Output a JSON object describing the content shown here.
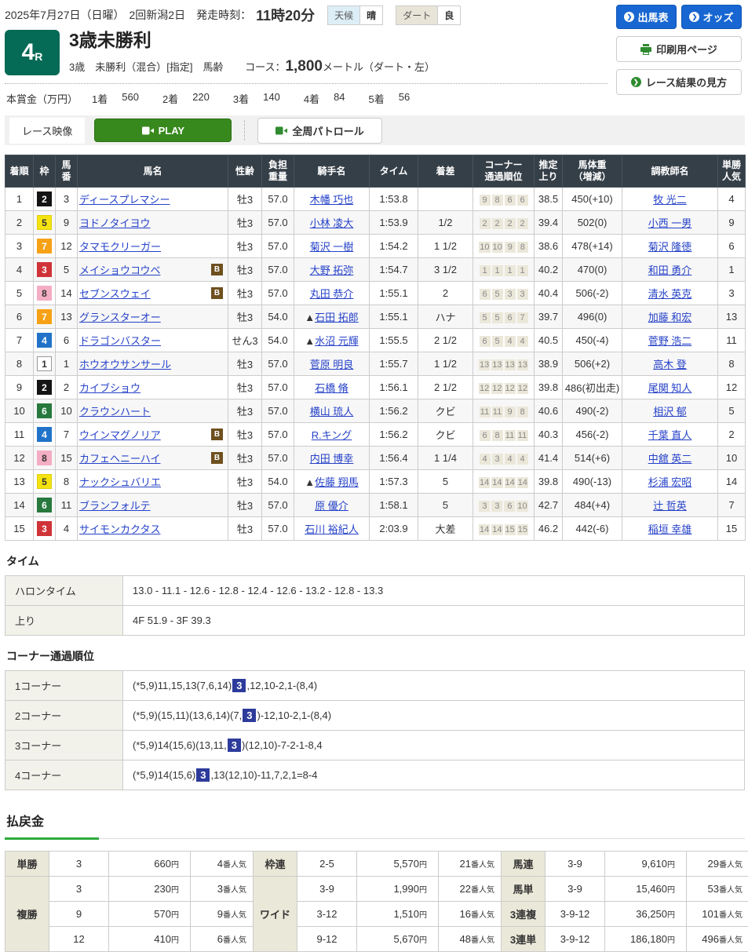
{
  "header": {
    "date": "2025年7月27日（日曜）",
    "meeting": "2回新潟2日",
    "start_label": "発走時刻：",
    "start_time": "11時20分",
    "weather_label": "天候",
    "weather_value": "晴",
    "track_label": "ダート",
    "track_value": "良",
    "btn_shutsuba": "出馬表",
    "btn_odds": "オッズ",
    "btn_print": "印刷用ページ",
    "btn_guide": "レース結果の見方"
  },
  "race": {
    "number": "4",
    "number_suffix": "R",
    "title": "3歳未勝利",
    "conditions": "3歳　未勝利（混合）[指定]　馬齢",
    "course_label": "コース：",
    "course_value": "1,800",
    "course_unit": "メートル（ダート・左）",
    "prize_label": "本賞金（万円）",
    "prizes": [
      {
        "place": "1着",
        "amount": "560"
      },
      {
        "place": "2着",
        "amount": "220"
      },
      {
        "place": "3着",
        "amount": "140"
      },
      {
        "place": "4着",
        "amount": "84"
      },
      {
        "place": "5着",
        "amount": "56"
      }
    ]
  },
  "video": {
    "label": "レース映像",
    "play": "PLAY",
    "patrol": "全周パトロール"
  },
  "waku_colors": {
    "1": {
      "bg": "#ffffff",
      "fg": "#333333",
      "border": "#999999"
    },
    "2": {
      "bg": "#141414",
      "fg": "#ffffff",
      "border": "#141414"
    },
    "3": {
      "bg": "#cf3337",
      "fg": "#ffffff",
      "border": "#cf3337"
    },
    "4": {
      "bg": "#2173c9",
      "fg": "#ffffff",
      "border": "#2173c9"
    },
    "5": {
      "bg": "#f5e311",
      "fg": "#333333",
      "border": "#e0cf10"
    },
    "6": {
      "bg": "#27793d",
      "fg": "#ffffff",
      "border": "#27793d"
    },
    "7": {
      "bg": "#f7a117",
      "fg": "#ffffff",
      "border": "#f7a117"
    },
    "8": {
      "bg": "#f4aec4",
      "fg": "#333333",
      "border": "#f4aec4"
    }
  },
  "results": {
    "blinker_label": "B",
    "headers": [
      "着順",
      "枠",
      "馬\n番",
      "馬名",
      "性齢",
      "負担\n重量",
      "騎手名",
      "タイム",
      "着差",
      "コーナー\n通過順位",
      "推定\n上り",
      "馬体重\n（増減）",
      "調教師名",
      "単勝\n人気"
    ],
    "rows": [
      {
        "pos": "1",
        "waku": "2",
        "num": "3",
        "horse": "ディースプレマシー",
        "blinker": false,
        "sexage": "牡3",
        "weight": "57.0",
        "jprefix": "",
        "jockey": "木幡 巧也",
        "time": "1:53.8",
        "margin": "",
        "corners": [
          "9",
          "8",
          "6",
          "6"
        ],
        "agari": "38.5",
        "hweight": "450(+10)",
        "trainer": "牧 光二",
        "pop": "4"
      },
      {
        "pos": "2",
        "waku": "5",
        "num": "9",
        "horse": "ヨドノタイヨウ",
        "blinker": false,
        "sexage": "牡3",
        "weight": "57.0",
        "jprefix": "",
        "jockey": "小林 凌大",
        "time": "1:53.9",
        "margin": "1/2",
        "corners": [
          "2",
          "2",
          "2",
          "2"
        ],
        "agari": "39.4",
        "hweight": "502(0)",
        "trainer": "小西 一男",
        "pop": "9"
      },
      {
        "pos": "3",
        "waku": "7",
        "num": "12",
        "horse": "タマモクリーガー",
        "blinker": false,
        "sexage": "牡3",
        "weight": "57.0",
        "jprefix": "",
        "jockey": "菊沢 一樹",
        "time": "1:54.2",
        "margin": "1 1/2",
        "corners": [
          "10",
          "10",
          "9",
          "8"
        ],
        "agari": "38.6",
        "hweight": "478(+14)",
        "trainer": "菊沢 隆徳",
        "pop": "6"
      },
      {
        "pos": "4",
        "waku": "3",
        "num": "5",
        "horse": "メイショウコウベ",
        "blinker": true,
        "sexage": "牡3",
        "weight": "57.0",
        "jprefix": "",
        "jockey": "大野 拓弥",
        "time": "1:54.7",
        "margin": "3 1/2",
        "corners": [
          "1",
          "1",
          "1",
          "1"
        ],
        "agari": "40.2",
        "hweight": "470(0)",
        "trainer": "和田 勇介",
        "pop": "1"
      },
      {
        "pos": "5",
        "waku": "8",
        "num": "14",
        "horse": "セブンスウェイ",
        "blinker": true,
        "sexage": "牡3",
        "weight": "57.0",
        "jprefix": "",
        "jockey": "丸田 恭介",
        "time": "1:55.1",
        "margin": "2",
        "corners": [
          "6",
          "5",
          "3",
          "3"
        ],
        "agari": "40.4",
        "hweight": "506(-2)",
        "trainer": "清水 英克",
        "pop": "3"
      },
      {
        "pos": "6",
        "waku": "7",
        "num": "13",
        "horse": "グランスターオー",
        "blinker": false,
        "sexage": "牡3",
        "weight": "54.0",
        "jprefix": "▲",
        "jockey": "石田 拓郎",
        "time": "1:55.1",
        "margin": "ハナ",
        "corners": [
          "5",
          "5",
          "6",
          "7"
        ],
        "agari": "39.7",
        "hweight": "496(0)",
        "trainer": "加藤 和宏",
        "pop": "13"
      },
      {
        "pos": "7",
        "waku": "4",
        "num": "6",
        "horse": "ドラゴンバスター",
        "blinker": false,
        "sexage": "せん3",
        "weight": "54.0",
        "jprefix": "▲",
        "jockey": "水沼 元輝",
        "time": "1:55.5",
        "margin": "2 1/2",
        "corners": [
          "6",
          "5",
          "4",
          "4"
        ],
        "agari": "40.5",
        "hweight": "450(-4)",
        "trainer": "菅野 浩二",
        "pop": "11"
      },
      {
        "pos": "8",
        "waku": "1",
        "num": "1",
        "horse": "ホウオウサンサール",
        "blinker": false,
        "sexage": "牡3",
        "weight": "57.0",
        "jprefix": "",
        "jockey": "菅原 明良",
        "time": "1:55.7",
        "margin": "1 1/2",
        "corners": [
          "13",
          "13",
          "13",
          "13"
        ],
        "agari": "38.9",
        "hweight": "506(+2)",
        "trainer": "高木 登",
        "pop": "8"
      },
      {
        "pos": "9",
        "waku": "2",
        "num": "2",
        "horse": "カイブショウ",
        "blinker": false,
        "sexage": "牡3",
        "weight": "57.0",
        "jprefix": "",
        "jockey": "石橋 脩",
        "time": "1:56.1",
        "margin": "2 1/2",
        "corners": [
          "12",
          "12",
          "12",
          "12"
        ],
        "agari": "39.8",
        "hweight": "486(初出走)",
        "trainer": "尾関 知人",
        "pop": "12"
      },
      {
        "pos": "10",
        "waku": "6",
        "num": "10",
        "horse": "クラウンハート",
        "blinker": false,
        "sexage": "牡3",
        "weight": "57.0",
        "jprefix": "",
        "jockey": "横山 琉人",
        "time": "1:56.2",
        "margin": "クビ",
        "corners": [
          "11",
          "11",
          "9",
          "8"
        ],
        "agari": "40.6",
        "hweight": "490(-2)",
        "trainer": "相沢 郁",
        "pop": "5"
      },
      {
        "pos": "11",
        "waku": "4",
        "num": "7",
        "horse": "ウインマグノリア",
        "blinker": true,
        "sexage": "牡3",
        "weight": "57.0",
        "jprefix": "",
        "jockey": "R.キング",
        "time": "1:56.2",
        "margin": "クビ",
        "corners": [
          "6",
          "8",
          "11",
          "11"
        ],
        "agari": "40.3",
        "hweight": "456(-2)",
        "trainer": "千葉 直人",
        "pop": "2"
      },
      {
        "pos": "12",
        "waku": "8",
        "num": "15",
        "horse": "カフェヘニーハイ",
        "blinker": true,
        "sexage": "牡3",
        "weight": "57.0",
        "jprefix": "",
        "jockey": "内田 博幸",
        "time": "1:56.4",
        "margin": "1 1/4",
        "corners": [
          "4",
          "3",
          "4",
          "4"
        ],
        "agari": "41.4",
        "hweight": "514(+6)",
        "trainer": "中舘 英二",
        "pop": "10"
      },
      {
        "pos": "13",
        "waku": "5",
        "num": "8",
        "horse": "ナックシュバリエ",
        "blinker": false,
        "sexage": "牡3",
        "weight": "54.0",
        "jprefix": "▲",
        "jockey": "佐藤 翔馬",
        "time": "1:57.3",
        "margin": "5",
        "corners": [
          "14",
          "14",
          "14",
          "14"
        ],
        "agari": "39.8",
        "hweight": "490(-13)",
        "trainer": "杉浦 宏昭",
        "pop": "14"
      },
      {
        "pos": "14",
        "waku": "6",
        "num": "11",
        "horse": "ブランフォルテ",
        "blinker": false,
        "sexage": "牡3",
        "weight": "57.0",
        "jprefix": "",
        "jockey": "原 優介",
        "time": "1:58.1",
        "margin": "5",
        "corners": [
          "3",
          "3",
          "6",
          "10"
        ],
        "agari": "42.7",
        "hweight": "484(+4)",
        "trainer": "辻 哲英",
        "pop": "7"
      },
      {
        "pos": "15",
        "waku": "3",
        "num": "4",
        "horse": "サイモンカクタス",
        "blinker": false,
        "sexage": "牡3",
        "weight": "57.0",
        "jprefix": "",
        "jockey": "石川 裕紀人",
        "time": "2:03.9",
        "margin": "大差",
        "corners": [
          "14",
          "14",
          "15",
          "15"
        ],
        "agari": "46.2",
        "hweight": "442(-6)",
        "trainer": "稲垣 幸雄",
        "pop": "15"
      }
    ]
  },
  "time_section": {
    "title": "タイム",
    "rows": [
      {
        "label": "ハロンタイム",
        "value": "13.0 - 11.1 - 12.6 - 12.8 - 12.4 - 12.6 - 13.2 - 12.8 - 13.3"
      },
      {
        "label": "上り",
        "value": "4F 51.9 - 3F 39.3"
      }
    ]
  },
  "corner_section": {
    "title": "コーナー通過順位",
    "rows": [
      {
        "label": "1コーナー",
        "pre": "(*5,9)11,15,13(7,6,14)",
        "hl": "3",
        "post": ",12,10-2,1-(8,4)"
      },
      {
        "label": "2コーナー",
        "pre": "(*5,9)(15,11)(13,6,14)(7,",
        "hl": "3",
        "post": ")-12,10-2,1-(8,4)"
      },
      {
        "label": "3コーナー",
        "pre": "(*5,9)14(15,6)(13,11,",
        "hl": "3",
        "post": ")(12,10)-7-2-1-8,4"
      },
      {
        "label": "4コーナー",
        "pre": "(*5,9)14(15,6)",
        "hl": "3",
        "post": ",13(12,10)-11,7,2,1=8-4"
      }
    ]
  },
  "payout": {
    "title": "払戻金",
    "yen_suffix": "円",
    "pop_suffix": "番人気",
    "groups": [
      {
        "rows": [
          {
            "label": "単勝",
            "cells": [
              {
                "combo": "3",
                "amount": "660",
                "pop": "4"
              }
            ]
          },
          {
            "label": "複勝",
            "cells": [
              {
                "combo": "3",
                "amount": "230",
                "pop": "3"
              },
              {
                "combo": "9",
                "amount": "570",
                "pop": "9"
              },
              {
                "combo": "12",
                "amount": "410",
                "pop": "6"
              }
            ]
          }
        ]
      },
      {
        "rows": [
          {
            "label": "枠連",
            "cells": [
              {
                "combo": "2-5",
                "amount": "5,570",
                "pop": "21"
              }
            ]
          },
          {
            "label": "ワイド",
            "cells": [
              {
                "combo": "3-9",
                "amount": "1,990",
                "pop": "22"
              },
              {
                "combo": "3-12",
                "amount": "1,510",
                "pop": "16"
              },
              {
                "combo": "9-12",
                "amount": "5,670",
                "pop": "48"
              }
            ]
          }
        ]
      },
      {
        "rows": [
          {
            "label": "馬連",
            "cells": [
              {
                "combo": "3-9",
                "amount": "9,610",
                "pop": "29"
              }
            ]
          },
          {
            "label": "馬単",
            "cells": [
              {
                "combo": "3-9",
                "amount": "15,460",
                "pop": "53"
              }
            ]
          },
          {
            "label": "3連複",
            "cells": [
              {
                "combo": "3-9-12",
                "amount": "36,250",
                "pop": "101"
              }
            ]
          },
          {
            "label": "3連単",
            "cells": [
              {
                "combo": "3-9-12",
                "amount": "186,180",
                "pop": "496"
              }
            ]
          }
        ]
      }
    ]
  }
}
